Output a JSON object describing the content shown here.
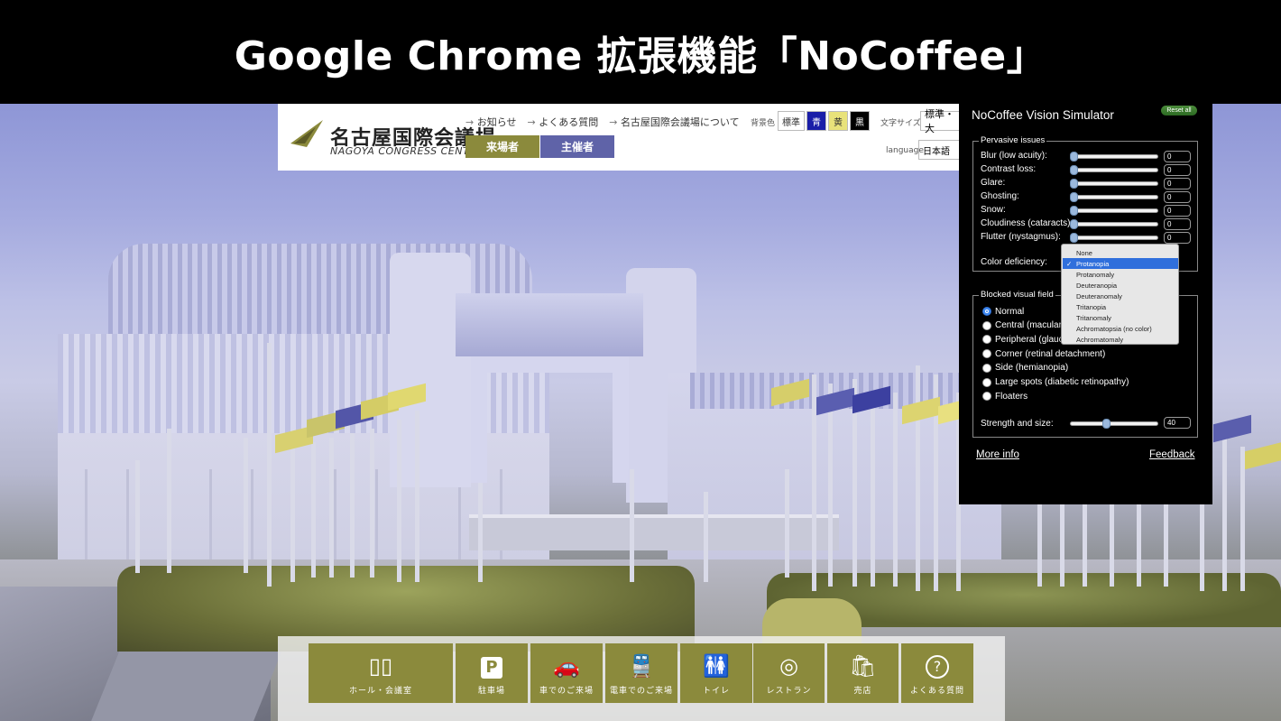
{
  "banner": {
    "title": "Google Chrome 拡張機能「NoCoffee」"
  },
  "site": {
    "logo_jp": "名古屋国際会議場",
    "logo_en": "NAGOYA CONGRESS CENTER",
    "nav_links": [
      "お知らせ",
      "よくある質問",
      "名古屋国際会議場について"
    ],
    "visitor_btn": "来場者",
    "organizer_btn": "主催者",
    "bg_label": "背景色",
    "bg_options": [
      "標準",
      "青",
      "黄",
      "黒"
    ],
    "font_size_label": "文字サイズ",
    "font_size_value": "標準・大",
    "language_label": "language",
    "language_value": "日本語",
    "colors": {
      "visitor": "#8b8a3c",
      "organizer": "#5f63a8",
      "blue": "#1a1ea8",
      "yellow": "#e8e27a",
      "black": "#000000"
    }
  },
  "bottom_nav": {
    "tiles": [
      {
        "icon": "door-icon",
        "glyph": "▯▯",
        "label": "ホール・会議室"
      },
      {
        "icon": "parking-icon",
        "glyph": "P",
        "label": "駐車場"
      },
      {
        "icon": "car-icon",
        "glyph": "🚗",
        "label": "車でのご来場"
      },
      {
        "icon": "train-icon",
        "glyph": "🚆",
        "label": "電車でのご来場"
      },
      {
        "icon": "restroom-icon",
        "glyph": "🚻",
        "label": "トイレ"
      },
      {
        "icon": "restaurant-icon",
        "glyph": "◎",
        "label": "レストラン"
      },
      {
        "icon": "shop-icon",
        "glyph": "🛍",
        "label": "売店"
      },
      {
        "icon": "help-icon",
        "glyph": "?",
        "label": "よくある質問"
      }
    ],
    "tile_color": "#8b8a3c"
  },
  "panel": {
    "title": "NoCoffee Vision Simulator",
    "reset_label": "Reset all",
    "pervasive_legend": "Pervasive issues",
    "sliders": [
      {
        "label": "Blur (low acuity):",
        "value": "0"
      },
      {
        "label": "Contrast loss:",
        "value": "0"
      },
      {
        "label": "Glare:",
        "value": "0"
      },
      {
        "label": "Ghosting:",
        "value": "0"
      },
      {
        "label": "Snow:",
        "value": "0"
      },
      {
        "label": "Cloudiness (cataracts):",
        "value": "0"
      },
      {
        "label": "Flutter (nystagmus):",
        "value": "0"
      }
    ],
    "color_deficiency_label": "Color deficiency:",
    "color_deficiency_options": [
      "None",
      "Protanopia",
      "Protanomaly",
      "Deuteranopia",
      "Deuteranomaly",
      "Tritanopia",
      "Tritanomaly",
      "Achromatopsia (no color)",
      "Achromatomaly"
    ],
    "color_deficiency_selected": "Protanopia",
    "blocked_legend": "Blocked visual field",
    "blocked_options": [
      {
        "label": "Normal",
        "checked": true
      },
      {
        "label": "Central (macular degeneration)",
        "checked": false
      },
      {
        "label": "Peripheral (glaucoma)",
        "checked": false
      },
      {
        "label": "Corner (retinal detachment)",
        "checked": false
      },
      {
        "label": "Side (hemianopia)",
        "checked": false
      },
      {
        "label": "Large spots (diabetic retinopathy)",
        "checked": false
      },
      {
        "label": "Floaters",
        "checked": false
      }
    ],
    "strength_label": "Strength and size:",
    "strength_value": "40",
    "more_info": "More info",
    "feedback": "Feedback"
  }
}
